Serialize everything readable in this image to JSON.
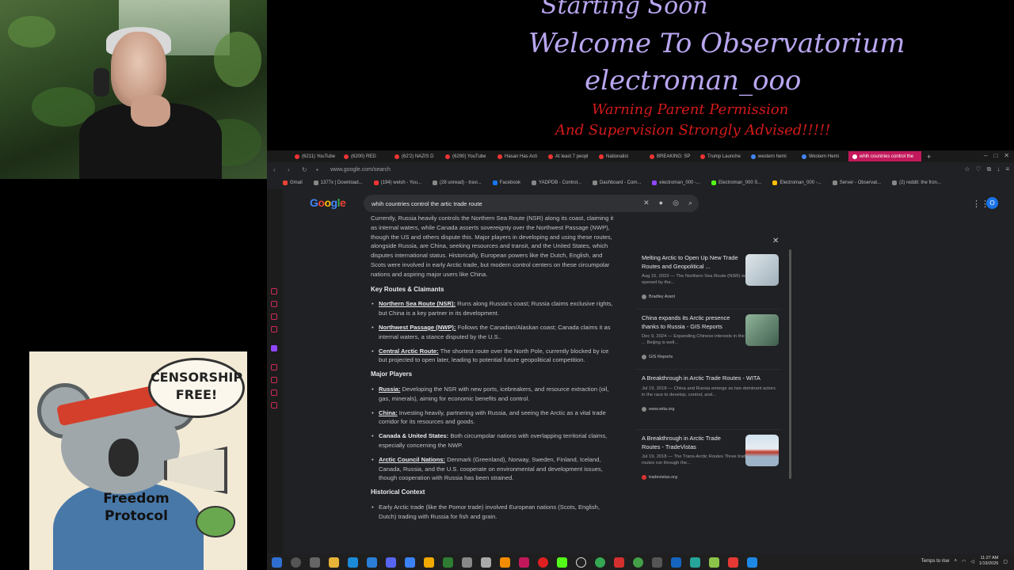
{
  "overlay": {
    "line1": "Starting Soon",
    "line2": "Welcome To Observatorium",
    "line3": "electroman_ooo",
    "warning1": "Warning Parent Permission",
    "warning2": "And Supervision Strongly Advised!!!!!"
  },
  "browser": {
    "tabs": [
      "(6211) YouTube",
      "(6200) RED",
      "(62'2) NAZIS D",
      "(6290) YouTube",
      "Hasan Has Acti",
      "At least 7 peopl",
      "Nationalist",
      "BREAKING: SP",
      "Trump Launche",
      "western hemi",
      "Western Hemi",
      "whih countries control the"
    ],
    "url": "www.google.com/search",
    "bookmarks": [
      "Gmail",
      "1377x | Download...",
      "(194) welsh - You...",
      "(28 unread) - travi...",
      "Facebook",
      "YADPDB - Control...",
      "Dashboard - Com...",
      "electroman_000 -...",
      "Electroman_000 S...",
      "Electroman_000 -...",
      "Server - Observat...",
      "(2) reddit: the fron..."
    ]
  },
  "search": {
    "query": "whih countries control the artic trade route",
    "avatar_letter": "O"
  },
  "answer": {
    "intro": "Currently, Russia heavily controls the Northern Sea Route (NSR) along its coast, claiming it as internal waters, while Canada asserts sovereignty over the Northwest Passage (NWP), though the US and others dispute this. Major players in developing and using these routes, alongside Russia, are China, seeking resources and transit, and the United States, which disputes international status. Historically, European powers like the Dutch, English, and Scots were involved in early Arctic trade, but modern control centers on these circumpolar nations and aspiring major users like China.",
    "heading1": "Key Routes & Claimants",
    "routes": [
      {
        "term": "Northern Sea Route (NSR):",
        "text": " Runs along Russia's coast; Russia claims exclusive rights, but China is a key partner in its development."
      },
      {
        "term": "Northwest Passage (NWP):",
        "text": " Follows the Canadian/Alaskan coast; Canada claims it as internal waters, a stance disputed by the U.S.."
      },
      {
        "term": "Central Arctic Route:",
        "text": " The shortest route over the North Pole, currently blocked by ice but projected to open later, leading to potential future geopolitical competition."
      }
    ],
    "heading2": "Major Players",
    "players": [
      {
        "term": "Russia:",
        "text": " Developing the NSR with new ports, icebreakers, and resource extraction (oil, gas, minerals), aiming for economic benefits and control."
      },
      {
        "term": "China:",
        "text": " Investing heavily, partnering with Russia, and seeing the Arctic as a vital trade corridor for its resources and goods."
      },
      {
        "term": "Canada & United States:",
        "text": " Both circumpolar nations with overlapping territorial claims, especially concerning the NWP."
      },
      {
        "term": "Arctic Council Nations:",
        "text": " Denmark (Greenland), Norway, Sweden, Finland, Iceland, Canada, Russia, and the U.S. cooperate on environmental and development issues, though cooperation with Russia has been strained."
      }
    ],
    "heading3": "Historical Context",
    "history": "Early Arctic trade (like the Pomor trade) involved European nations (Scots, English, Dutch) trading with Russia for fish and grain."
  },
  "sources": [
    {
      "title": "Melting Arctic to Open Up New Trade Routes and Geopolitical ...",
      "snippet": "Aug 15, 2023 — The Northern Sea Route (NSR) was first opened by the...",
      "source": "Bradley Arant",
      "thumb": "#c9d3d8"
    },
    {
      "title": "China expands its Arctic presence thanks to Russia - GIS Reports",
      "snippet": "Dec 9, 2024 — Expanding Chinese interests in the Arctic ... Beijing is well...",
      "source": "GIS Reports",
      "thumb": "#6f8a78"
    },
    {
      "title": "A Breakthrough in Arctic Trade Routes - WITA",
      "snippet": "Jul 19, 2018 — China and Russia emerge as two dominant actors in the race to develop, control, and...",
      "source": "www.wita.org",
      "thumb": ""
    },
    {
      "title": "A Breakthrough in Arctic Trade Routes - TradeVistas",
      "snippet": "Jul 19, 2018 — The Trans-Arctic Routes Three trade routes run through the...",
      "source": "tradevistas.org",
      "thumb": "#b8c7d6"
    }
  ],
  "poster": {
    "bubble": "CENSORSHIP FREE!",
    "hoodie": "Freedom Protocol"
  },
  "taskbar": {
    "weather": "Temps to rise",
    "time": "11:27 AM",
    "date": "1/19/2026"
  },
  "colors": {
    "overlay_purple": "#b9a6f0",
    "warning_red": "#d21a1a",
    "active_tab": "#c2185b"
  }
}
